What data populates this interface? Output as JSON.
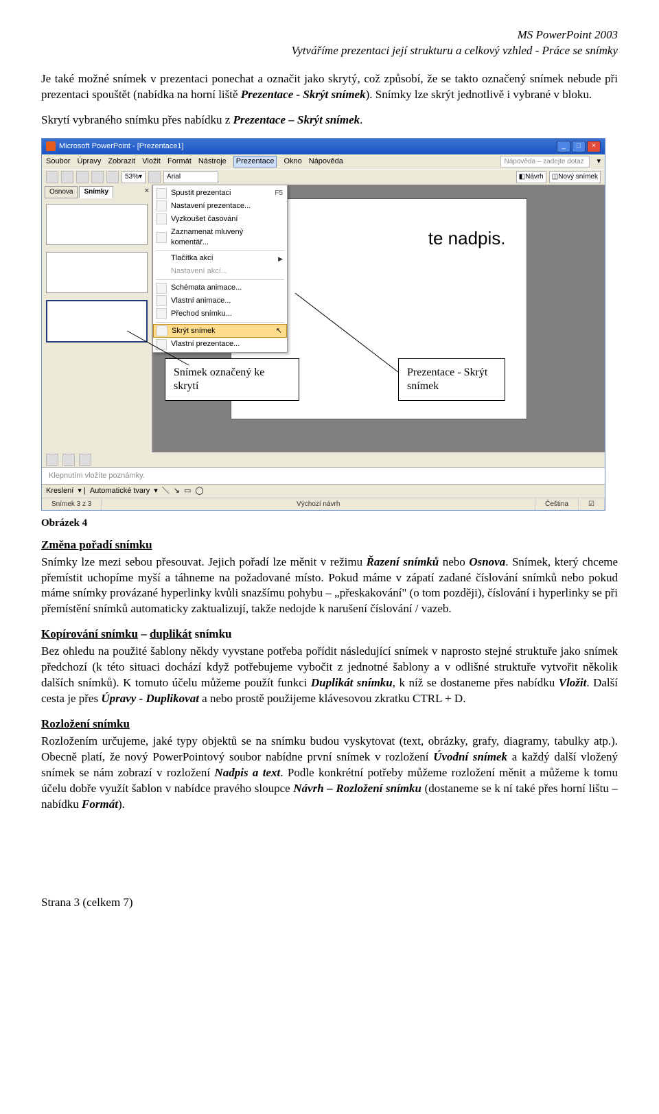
{
  "header": {
    "line1": "MS PowerPoint 2003",
    "line2": "Vytváříme prezentaci její strukturu a celkový vzhled - Práce se snímky"
  },
  "para1": {
    "t1": "Je také možné snímek v prezentaci ponechat a označit jako skrytý, což způsobí, že se takto označený snímek nebude při prezentaci spouštět (nabídka na horní liště ",
    "i1": "Prezentace - Skrýt snímek",
    "t2": "). Snímky lze skrýt jednotlivě i vybrané v bloku."
  },
  "para2": {
    "t1": "Skrytí vybraného snímku přes nabídku z ",
    "i1": "Prezentace – Skrýt snímek",
    "t2": "."
  },
  "app": {
    "title": "Microsoft PowerPoint - [Prezentace1]",
    "menu": [
      "Soubor",
      "Úpravy",
      "Zobrazit",
      "Vložit",
      "Formát",
      "Nástroje",
      "Prezentace",
      "Okno",
      "Nápověda"
    ],
    "help_ph": "Nápověda – zadejte dotaz",
    "zoom": "53%",
    "font": "Arial",
    "navrh_btn": "Návrh",
    "novy_btn": "Nový snímek",
    "tabs": {
      "osnova": "Osnova",
      "snimky": "Snímky"
    },
    "slide_placeholder": "te nadpis.",
    "dropdown": [
      {
        "label": "Spustit prezentaci",
        "sc": "F5",
        "icon": true
      },
      {
        "label": "Nastavení prezentace...",
        "icon": true
      },
      {
        "label": "Vyzkoušet časování",
        "icon": true
      },
      {
        "label": "Zaznamenat mluvený komentář...",
        "icon": true
      },
      {
        "label": "Tlačítka akcí",
        "arrow": true
      },
      {
        "label": "Nastavení akcí...",
        "disabled": true
      },
      {
        "label": "Schémata animace...",
        "icon": true
      },
      {
        "label": "Vlastní animace...",
        "icon": true
      },
      {
        "label": "Přechod snímku...",
        "icon": true
      },
      {
        "label": "Skrýt snímek",
        "hl": true,
        "icon": true
      },
      {
        "label": "Vlastní prezentace...",
        "icon": true
      }
    ],
    "notes": "Klepnutím vložíte poznámky.",
    "draw": {
      "kresleni": "Kreslení",
      "autoshapes": "Automatické tvary"
    },
    "status": {
      "left": "Snímek 3 z 3",
      "mid": "Výchozí návrh",
      "lang": "Čeština"
    }
  },
  "callout_left": "Snímek označený ke skrytí",
  "callout_right": "Prezentace - Skrýt snímek",
  "fig_label": "Obrázek 4",
  "sec_zmena": {
    "title": "Změna pořadí snímku",
    "t1": "Snímky lze mezi sebou přesouvat. Jejich pořadí lze měnit v režimu ",
    "i1": "Řazení snímků",
    "t2": " nebo ",
    "i2": "Osnova",
    "t3": ". Snímek, který chceme přemístit uchopíme myší a táhneme na požadované místo. Pokud máme v zápatí zadané číslování snímků nebo pokud máme snímky provázané hyperlinky kvůli snazšímu pohybu – „přeskakování\" (o tom později), číslování i hyperlinky se při přemístění snímků automaticky zaktualizují, takže nedojde k narušení číslování / vazeb."
  },
  "sec_kopir": {
    "title_a": "Kopírování snímku",
    "title_mid": " – ",
    "title_b": "duplikát",
    "title_c": " snímku",
    "t1": "Bez ohledu na použité šablony někdy vyvstane potřeba pořídit následující snímek v naprosto stejné struktuře jako snímek předchozí (k této situaci dochází když potřebujeme vybočit z jednotné šablony a v odlišné struktuře vytvořit několik dalších snímků). K tomuto účelu můžeme použít funkci ",
    "i1": "Duplikát snímku",
    "t2": ", k níž se dostaneme přes nabídku ",
    "i2": "Vložit",
    "t3": ". Další cesta je přes ",
    "i3": "Úpravy - Duplikovat",
    "t4": "  a nebo prostě použijeme klávesovou zkratku CTRL + D."
  },
  "sec_rozlo": {
    "title": "Rozložení snímku",
    "t1": "Rozložením určujeme, jaké typy objektů se na snímku budou vyskytovat (text, obrázky, grafy, diagramy, tabulky atp.). Obecně platí, že nový PowerPointový soubor nabídne první snímek v rozložení ",
    "i1": "Úvodní snímek",
    "t2": " a každý další vložený snímek se nám zobrazí v rozložení ",
    "i2": "Nadpis a text",
    "t3": ". Podle konkrétní potřeby můžeme rozložení  měnit a můžeme k tomu účelu dobře využít šablon v nabídce pravého sloupce ",
    "i3": "Návrh – Rozložení snímku",
    "t4": " (dostaneme se k ní také přes horní lištu – nabídku ",
    "i4": "Formát",
    "t5": ")."
  },
  "footer": "Strana 3 (celkem 7)"
}
